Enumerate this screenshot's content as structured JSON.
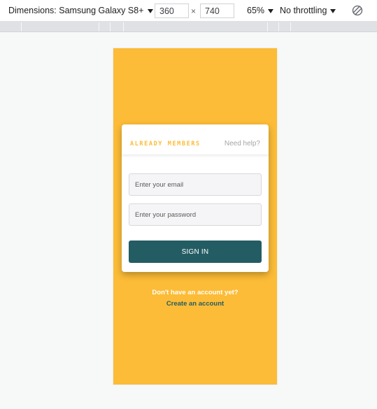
{
  "devtools": {
    "device_label": "Dimensions: Samsung Galaxy S8+",
    "width": "360",
    "times": "×",
    "height": "740",
    "zoom": "65%",
    "throttling": "No throttling",
    "rotate_icon": "rotate-icon"
  },
  "login": {
    "title": "ALREADY MEMBERS",
    "need_help": "Need help?",
    "email_placeholder": "Enter your email",
    "password_placeholder": "Enter your password",
    "sign_in_label": "SIGN IN",
    "no_account_text": "Don't have an account yet?",
    "create_account_label": "Create an account"
  },
  "colors": {
    "background": "#fcbc37",
    "accent": "#245c63",
    "card": "#ffffff"
  }
}
